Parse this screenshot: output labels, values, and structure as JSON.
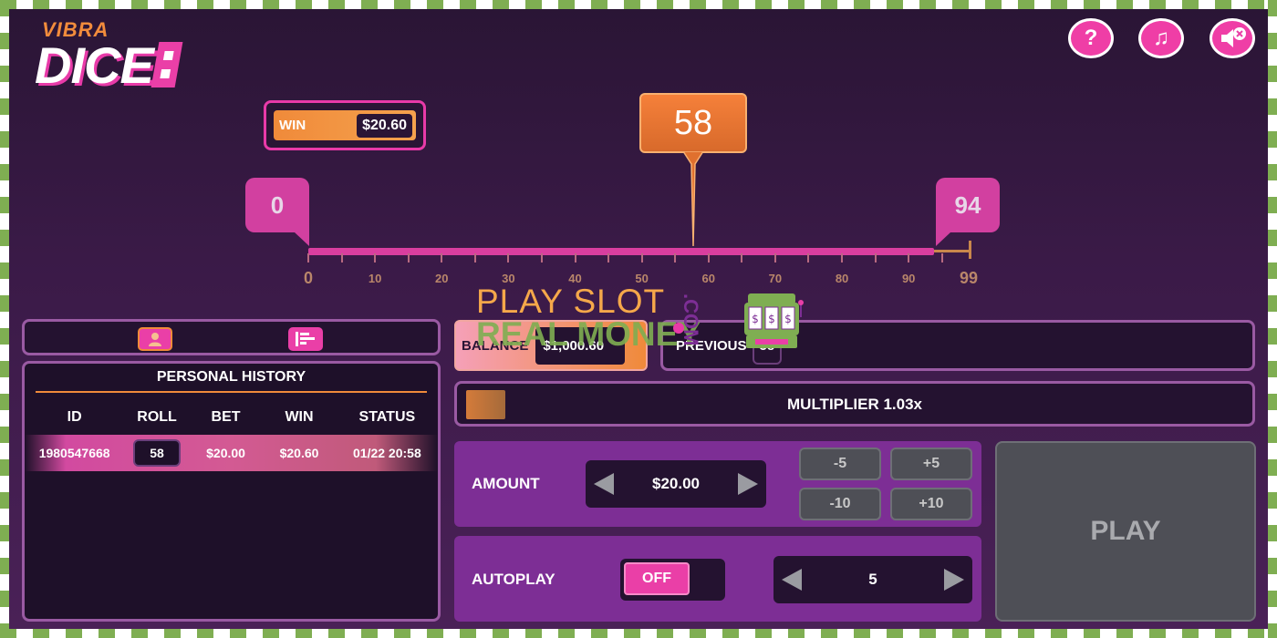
{
  "logo": {
    "top": "VIBRA",
    "main": "DICE"
  },
  "header_buttons": [
    {
      "name": "help-button",
      "icon": "question-icon",
      "glyph": "?"
    },
    {
      "name": "music-button",
      "icon": "music-note-icon",
      "glyph": "♫"
    },
    {
      "name": "sound-button",
      "icon": "speaker-muted-icon",
      "glyph": ""
    }
  ],
  "win": {
    "label": "WIN",
    "value": "$20.60"
  },
  "result": {
    "value": "58",
    "position": 58
  },
  "range": {
    "min_label": "0",
    "max_label": "94",
    "min": 0,
    "max": 94
  },
  "scale": {
    "labels": [
      "0",
      "10",
      "20",
      "30",
      "40",
      "50",
      "60",
      "70",
      "80",
      "90",
      "99"
    ]
  },
  "history": {
    "title": "PERSONAL HISTORY",
    "columns": [
      "ID",
      "ROLL",
      "BET",
      "WIN",
      "STATUS"
    ],
    "rows": [
      {
        "id": "1980547668",
        "roll": "58",
        "bet": "$20.00",
        "win": "$20.60",
        "status": "01/22 20:58"
      }
    ]
  },
  "balance": {
    "label": "BALANCE",
    "value": "$1,000.60"
  },
  "previous": {
    "label": "PREVIOUS",
    "value": "58"
  },
  "multiplier": {
    "label": "MULTIPLIER 1.03x",
    "fill_fraction": 0.05
  },
  "amount": {
    "label": "AMOUNT",
    "value": "$20.00",
    "quick": [
      "-5",
      "+5",
      "-10",
      "+10"
    ]
  },
  "autoplay": {
    "label": "AUTOPLAY",
    "toggle": "OFF",
    "count": "5"
  },
  "play": {
    "label": "PLAY"
  },
  "watermark": {
    "line1": "PLAY SLOT",
    "line2": "REAL MONEY",
    "domain": ".COM"
  },
  "colors": {
    "accent_pink": "#ea3fa7",
    "accent_orange": "#f08a3a",
    "panel_purple": "#7d2e95",
    "bg_dark": "#2a1535",
    "disabled_gray": "#4e4f56"
  }
}
